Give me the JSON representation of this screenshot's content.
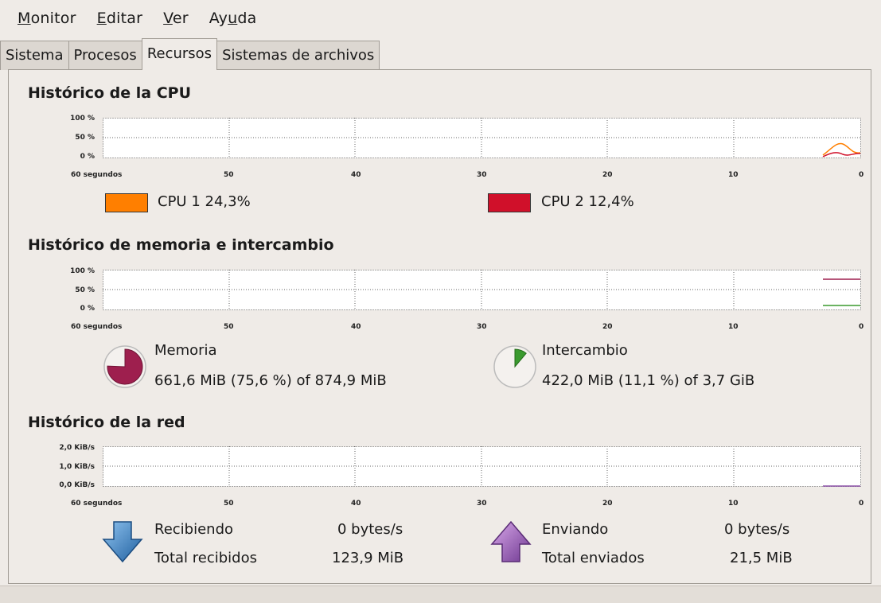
{
  "menubar": {
    "items": [
      {
        "underline": "M",
        "rest": "onitor"
      },
      {
        "underline": "E",
        "rest": "ditar"
      },
      {
        "underline": "V",
        "rest": "er"
      },
      {
        "pre": "Ay",
        "underline": "u",
        "rest": "da"
      }
    ]
  },
  "tabs": [
    "Sistema",
    "Procesos",
    "Recursos",
    "Sistemas de archivos"
  ],
  "active_tab": "Recursos",
  "cpu": {
    "title": "Histórico de la CPU",
    "y_ticks": [
      "100 %",
      "50 %",
      "0 %"
    ],
    "x_ticks": [
      "60 segundos",
      "50",
      "40",
      "30",
      "20",
      "10",
      "0"
    ],
    "legend": [
      {
        "label": "CPU 1",
        "value": "24,3%",
        "color": "#ff7f00"
      },
      {
        "label": "CPU 2",
        "value": "12,4%",
        "color": "#d0102a"
      }
    ]
  },
  "memory": {
    "title": "Histórico de memoria e intercambio",
    "y_ticks": [
      "100 %",
      "50 %",
      "0 %"
    ],
    "x_ticks": [
      "60 segundos",
      "50",
      "40",
      "30",
      "20",
      "10",
      "0"
    ],
    "items": [
      {
        "label": "Memoria",
        "detail": "661,6 MiB (75,6 %) of 874,9 MiB",
        "fraction": 0.756,
        "color": "#9e1f4e"
      },
      {
        "label": "Intercambio",
        "detail": "422,0 MiB (11,1 %) of 3,7 GiB",
        "fraction": 0.111,
        "color": "#3a9a2e"
      }
    ]
  },
  "network": {
    "title": "Histórico de la red",
    "y_ticks": [
      "2,0 KiB/s",
      "1,0 KiB/s",
      "0,0 KiB/s"
    ],
    "x_ticks": [
      "60 segundos",
      "50",
      "40",
      "30",
      "20",
      "10",
      "0"
    ],
    "receiving_label": "Recibiendo",
    "receiving_value": "0 bytes/s",
    "total_received_label": "Total recibidos",
    "total_received_value": "123,9 MiB",
    "sending_label": "Enviando",
    "sending_value": "0 bytes/s",
    "total_sent_label": "Total enviados",
    "total_sent_value": "21,5 MiB",
    "receive_color": "#2f6fb5",
    "send_color": "#8a4fa6"
  }
}
